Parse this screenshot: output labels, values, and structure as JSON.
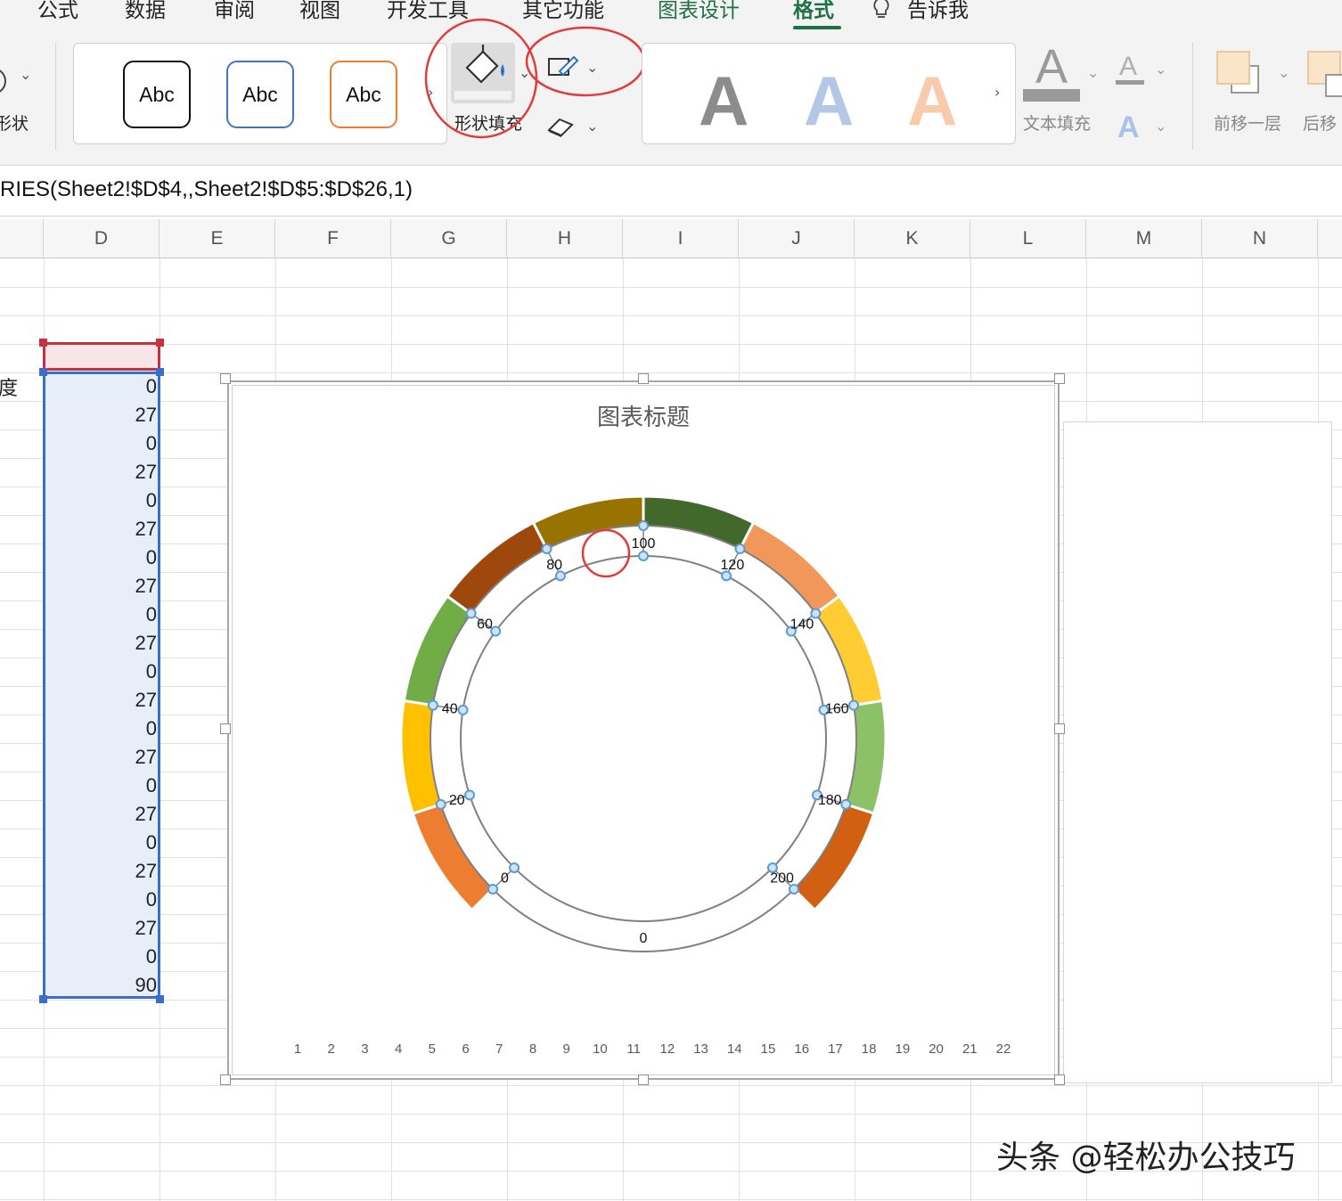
{
  "ribbon": {
    "tabs": [
      {
        "label": "公式",
        "style": "normal"
      },
      {
        "label": "数据",
        "style": "normal"
      },
      {
        "label": "审阅",
        "style": "normal"
      },
      {
        "label": "视图",
        "style": "normal"
      },
      {
        "label": "开发工具",
        "style": "normal"
      },
      {
        "label": "其它功能",
        "style": "normal"
      },
      {
        "label": "图表设计",
        "style": "green"
      },
      {
        "label": "格式",
        "style": "active"
      },
      {
        "label": "告诉我",
        "style": "normal"
      }
    ],
    "shape_group_label": "形状",
    "shape_styles": [
      {
        "label": "Abc",
        "color": "#111111"
      },
      {
        "label": "Abc",
        "color": "#4472c4"
      },
      {
        "label": "Abc",
        "color": "#ed7d31"
      }
    ],
    "shape_fill_label": "形状填充",
    "wordart_letter": "A",
    "text_fill_label": "文本填充",
    "bring_forward_label": "前移一层",
    "send_backward_label": "后移",
    "accent_color": "#1e7145"
  },
  "formula_bar": {
    "text": "RIES(Sheet2!$D$4,,Sheet2!$D$5:$D$26,1)"
  },
  "columns": [
    "D",
    "E",
    "F",
    "G",
    "H",
    "I",
    "J",
    "K",
    "L",
    "M",
    "N"
  ],
  "sheet": {
    "row_label": "度",
    "values": [
      "0",
      "27",
      "0",
      "27",
      "0",
      "27",
      "0",
      "27",
      "0",
      "27",
      "0",
      "27",
      "0",
      "27",
      "0",
      "27",
      "0",
      "27",
      "0",
      "27",
      "0",
      "90"
    ]
  },
  "chart_data": {
    "type": "doughnut",
    "title": "图表标题",
    "categories": [
      "1",
      "2",
      "3",
      "4",
      "5",
      "6",
      "7",
      "8",
      "9",
      "10",
      "11",
      "12",
      "13",
      "14",
      "15",
      "16",
      "17",
      "18",
      "19",
      "20",
      "21",
      "22"
    ],
    "outer_ring": {
      "segments": [
        {
          "span": 27,
          "color": "#ed7d31"
        },
        {
          "span": 27,
          "color": "#ffc000"
        },
        {
          "span": 27,
          "color": "#70ad47"
        },
        {
          "span": 27,
          "color": "#9e480e"
        },
        {
          "span": 27,
          "color": "#997300"
        },
        {
          "span": 27,
          "color": "#43682b"
        },
        {
          "span": 27,
          "color": "#f1975a"
        },
        {
          "span": 27,
          "color": "#ffcd33"
        },
        {
          "span": 27,
          "color": "#8cc168"
        },
        {
          "span": 27,
          "color": "#d26012"
        }
      ],
      "gap": 90
    },
    "inner_ring": {
      "values": [
        0,
        27,
        0,
        27,
        0,
        27,
        0,
        27,
        0,
        27,
        0,
        27,
        0,
        27,
        0,
        27,
        0,
        27,
        0,
        27,
        0,
        90
      ],
      "tick_labels": [
        "0",
        "20",
        "40",
        "60",
        "80",
        "100",
        "120",
        "140",
        "160",
        "180",
        "200"
      ],
      "gap_label": "0",
      "stroke_color": "#808080",
      "point_color": "#5b9bd5"
    },
    "selection_circle_color": "#e03c3c"
  },
  "watermark": "头条 @轻松办公技巧"
}
